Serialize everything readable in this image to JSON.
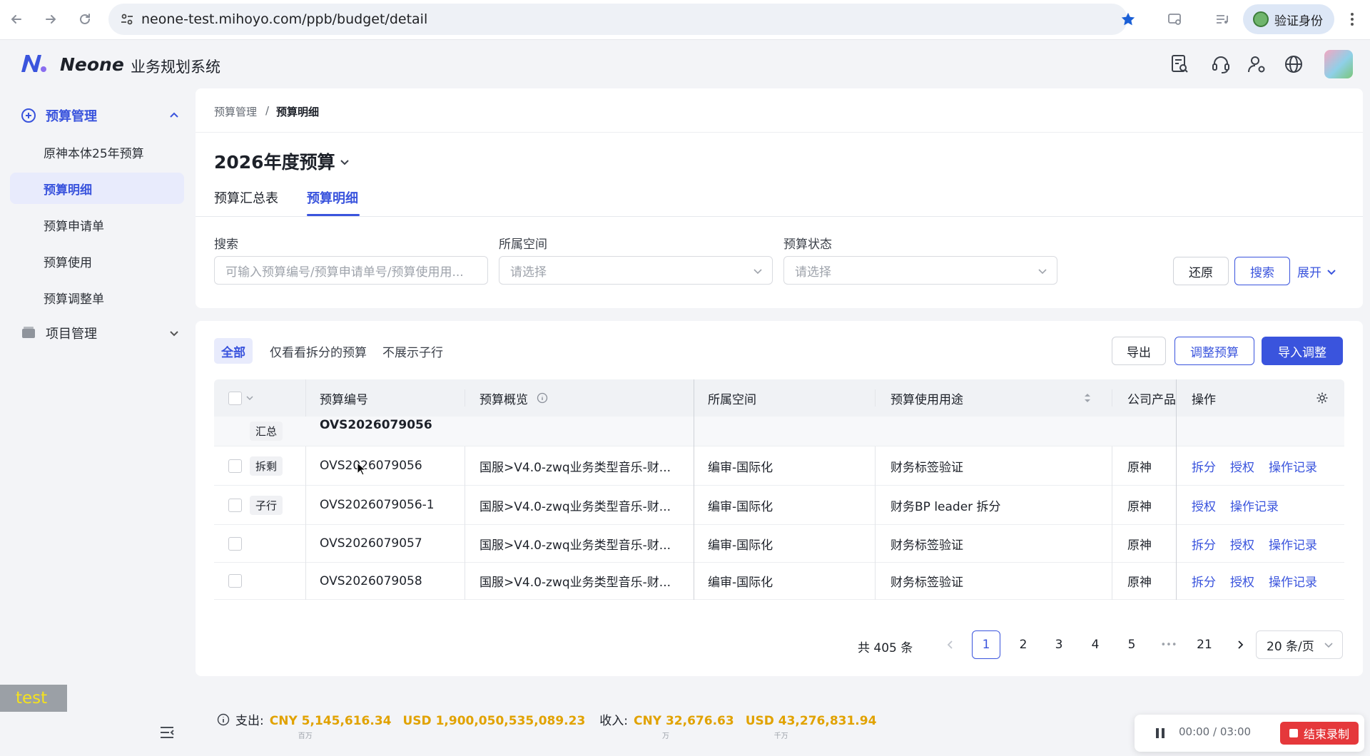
{
  "browser": {
    "url": "neone-test.mihoyo.com/ppb/budget/detail",
    "verify_label": "验证身份"
  },
  "app": {
    "brand": "Neone",
    "system": "业务规划系统",
    "icons": [
      "document-search-icon",
      "headset-icon",
      "user-settings-icon",
      "globe-icon"
    ]
  },
  "sidebar": {
    "group_budget": "预算管理",
    "items": [
      "原神本体25年预算",
      "预算明细",
      "预算申请单",
      "预算使用",
      "预算调整单"
    ],
    "active_index": 1,
    "group_project": "项目管理",
    "test_tag": "test"
  },
  "breadcrumb": {
    "parent": "预算管理",
    "sep": "/",
    "current": "预算明细"
  },
  "page": {
    "title": "2026年度预算",
    "tabs": [
      "预算汇总表",
      "预算明细"
    ],
    "active_tab": 1
  },
  "filters": {
    "search_label": "搜索",
    "search_placeholder": "可输入预算编号/预算申请单号/预算使用用...",
    "space_label": "所属空间",
    "space_placeholder": "请选择",
    "status_label": "预算状态",
    "status_placeholder": "请选择",
    "reset": "还原",
    "search_btn": "搜索",
    "expand": "展开"
  },
  "table_toolbar": {
    "segments": [
      "全部",
      "仅看看拆分的预算",
      "不展示子行"
    ],
    "export": "导出",
    "adjust": "调整预算",
    "import_adjust": "导入调整"
  },
  "table": {
    "headers": {
      "code": "预算编号",
      "overview": "预算概览",
      "space": "所属空间",
      "usage": "预算使用用途",
      "product": "公司产品",
      "ops": "操作"
    },
    "summary_row": {
      "tag": "汇总",
      "code": "OVS2026079056"
    },
    "rows": [
      {
        "tag": "拆剩",
        "code": "OVS2026079056",
        "overview": "国服>V4.0-zwq业务类型音乐-财...",
        "space": "编审-国际化",
        "usage": "财务标签验证",
        "product": "原神",
        "ops": [
          "拆分",
          "授权",
          "操作记录"
        ]
      },
      {
        "tag": "子行",
        "code": "OVS2026079056-1",
        "overview": "国服>V4.0-zwq业务类型音乐-财...",
        "space": "编审-国际化",
        "usage": "财务BP leader 拆分",
        "product": "原神",
        "ops": [
          "授权",
          "操作记录"
        ]
      },
      {
        "tag": "",
        "code": "OVS2026079057",
        "overview": "国服>V4.0-zwq业务类型音乐-财...",
        "space": "编审-国际化",
        "usage": "财务标签验证",
        "product": "原神",
        "ops": [
          "拆分",
          "授权",
          "操作记录"
        ]
      },
      {
        "tag": "",
        "code": "OVS2026079058",
        "overview": "国服>V4.0-zwq业务类型音乐-财...",
        "space": "编审-国际化",
        "usage": "财务标签验证",
        "product": "原神",
        "ops": [
          "拆分",
          "授权",
          "操作记录"
        ]
      }
    ]
  },
  "pagination": {
    "total": "共 405 条",
    "pages": [
      "1",
      "2",
      "3",
      "4",
      "5",
      "•••",
      "21"
    ],
    "current": "1",
    "page_size": "20 条/页"
  },
  "footer": {
    "expense_label": "支出:",
    "expense_cny": "CNY 5,145,616.34",
    "expense_cny_unit": "百万",
    "expense_usd": "USD 1,900,050,535,089.23",
    "income_label": "收入:",
    "income_cny": "CNY 32,676.63",
    "income_cny_unit": "万",
    "income_usd": "USD 43,276,831.94",
    "income_usd_unit": "千万"
  },
  "recorder": {
    "time": "00:00 / 03:00",
    "stop": "结束录制"
  },
  "colors": {
    "primary": "#3a54dd",
    "amount": "#e1a200",
    "record": "#e5383b"
  }
}
